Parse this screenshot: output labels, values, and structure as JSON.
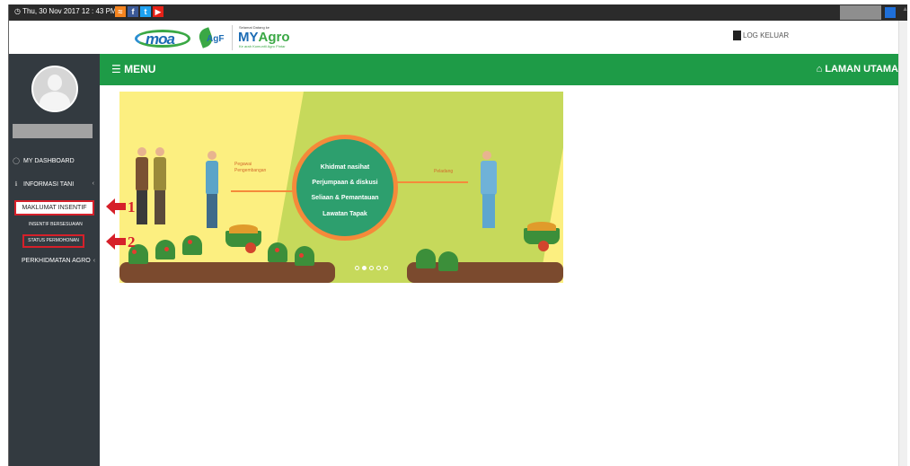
{
  "topbar": {
    "datetime": "Thu, 30 Nov 2017 12 : 43 PM",
    "social_icons": [
      "rss-icon",
      "facebook-icon",
      "twitter-icon",
      "youtube-icon"
    ]
  },
  "header": {
    "logo_moa": "moa",
    "logo_agf": "AgF",
    "myagro_small": "Selamat Datang ke",
    "myagro_title_a": "MY",
    "myagro_title_b": "Agro",
    "myagro_tag": "Ke arah Komuniti Agro Pintar",
    "logout_label": "LOG KELUAR"
  },
  "menubar": {
    "menu_label": "MENU",
    "home_label": "LAMAN UTAMA"
  },
  "sidebar": {
    "dashboard": "MY DASHBOARD",
    "info_tani": "INFORMASI TANI",
    "maklumat_insentif": "MAKLUMAT INSENTIF",
    "insentif_bersesuaian": "INSENTIF BERSESUAIAN",
    "status_permohonan": "STATUS PERMOHONAN",
    "perkhidmatan_agro": "PERKHIDMATAN AGRO"
  },
  "banner": {
    "circle_lines": [
      "Khidmat nasihat",
      "Perjumpaan & diskusi",
      "Seliaan & Pemantauan",
      "Lawatan Tapak"
    ],
    "label_left_1": "Pegawai",
    "label_left_2": "Pengembangan",
    "label_right": "Peladang",
    "slide_count": 5,
    "active_slide": 2
  },
  "annotations": {
    "arrow1_number": "1",
    "arrow2_number": "2",
    "highlight_color": "#d6202a"
  },
  "colors": {
    "menu_green": "#1e9b47",
    "sidebar_dark": "#333a40",
    "topbar_dark": "#2b2b2b"
  }
}
